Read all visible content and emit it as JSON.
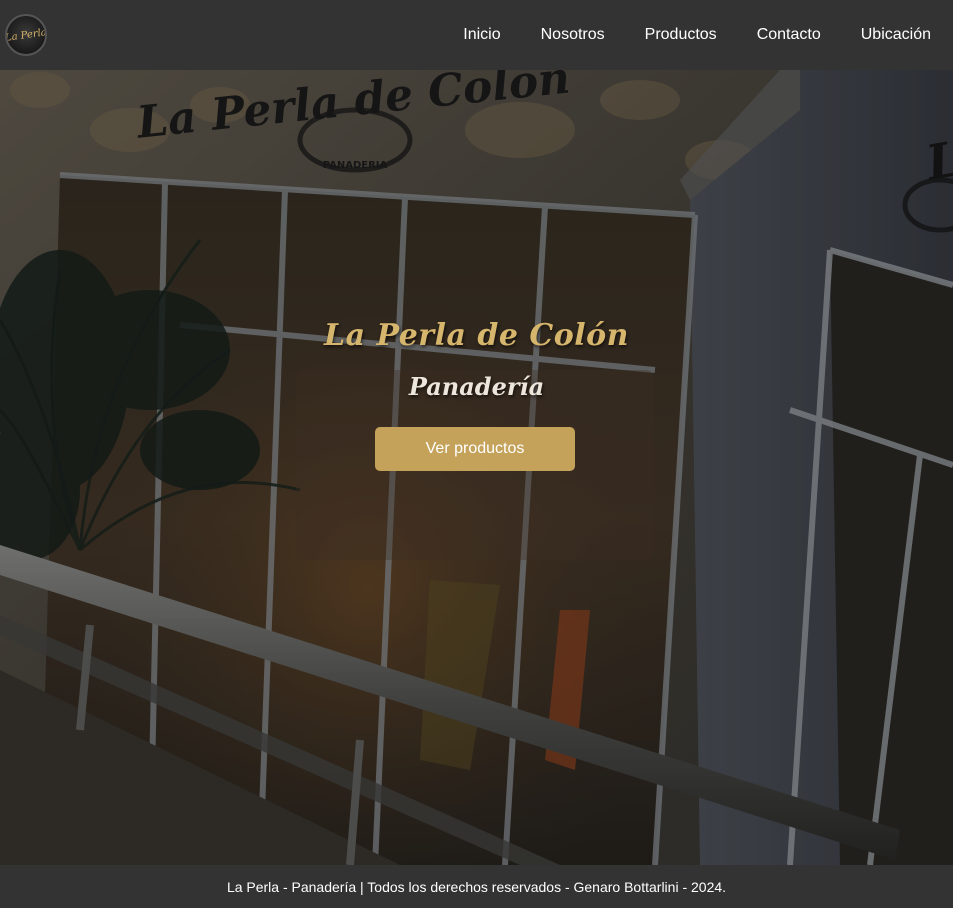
{
  "brand": {
    "logo_text": "La Perla"
  },
  "nav": {
    "items": [
      {
        "label": "Inicio"
      },
      {
        "label": "Nosotros"
      },
      {
        "label": "Productos"
      },
      {
        "label": "Contacto"
      },
      {
        "label": "Ubicación"
      }
    ]
  },
  "hero": {
    "title": "La Perla de Colón",
    "subtitle": "Panadería",
    "button_label": "Ver productos",
    "storefront_sign": "La Perla de Colón",
    "storefront_sign_sub": "PANADERIA"
  },
  "footer": {
    "text": "La Perla - Panadería | Todos los derechos reservados - Genaro Bottarlini - 2024."
  },
  "colors": {
    "nav_bg": "#333333",
    "accent_gold": "#c5a25a",
    "title_gold": "#d6b56d",
    "footer_bg": "#333333"
  }
}
